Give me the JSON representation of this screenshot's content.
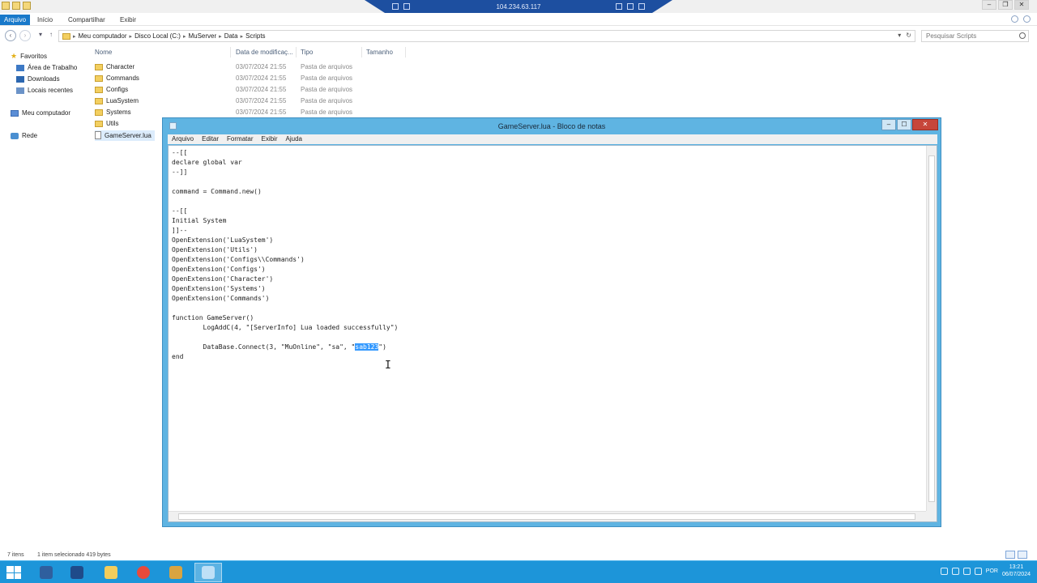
{
  "rdp": {
    "ip": "104.234.63.117"
  },
  "ribbon": {
    "tabs": [
      "Arquivo",
      "Início",
      "Compartilhar",
      "Exibir"
    ]
  },
  "address": {
    "crumbs": [
      "Meu computador",
      "Disco Local (C:)",
      "MuServer",
      "Data",
      "Scripts"
    ],
    "search_placeholder": "Pesquisar Scripts"
  },
  "navpane": {
    "favorites": "Favoritos",
    "desktop": "Área de Trabalho",
    "downloads": "Downloads",
    "recent": "Locais recentes",
    "computer": "Meu computador",
    "network": "Rede"
  },
  "filelist": {
    "columns": [
      "Nome",
      "Data de modificaç...",
      "Tipo",
      "Tamanho"
    ],
    "rows": [
      {
        "name": "Character",
        "date": "03/07/2024 21:55",
        "type": "Pasta de arquivos"
      },
      {
        "name": "Commands",
        "date": "03/07/2024 21:55",
        "type": "Pasta de arquivos"
      },
      {
        "name": "Configs",
        "date": "03/07/2024 21:55",
        "type": "Pasta de arquivos"
      },
      {
        "name": "LuaSystem",
        "date": "03/07/2024 21:55",
        "type": "Pasta de arquivos"
      },
      {
        "name": "Systems",
        "date": "03/07/2024 21:55",
        "type": "Pasta de arquivos"
      },
      {
        "name": "Utils",
        "date": "",
        "type": ""
      },
      {
        "name": "GameServer.lua",
        "date": "",
        "type": ""
      }
    ]
  },
  "status": {
    "count": "7 itens",
    "selected": "1 item selecionado  419 bytes"
  },
  "notepad": {
    "title": "GameServer.lua - Bloco de notas",
    "menus": [
      "Arquivo",
      "Editar",
      "Formatar",
      "Exibir",
      "Ajuda"
    ],
    "lines": [
      "--[[",
      "declare global var",
      "--]]",
      "",
      "command = Command.new()",
      "",
      "--[[",
      "Initial System",
      "]]--",
      "OpenExtension('LuaSystem')",
      "OpenExtension('Utils')",
      "OpenExtension('Configs\\\\Commands')",
      "OpenExtension('Configs')",
      "OpenExtension('Character')",
      "OpenExtension('Systems')",
      "OpenExtension('Commands')",
      "",
      "function GameServer()",
      "        LogAddC(4, \"[ServerInfo] Lua loaded successfully\")",
      "",
      "        DataBase.Connect(3, \"MuOnline\", \"sa\", \"",
      "end"
    ],
    "selected_line_index": 20,
    "selected_text": "sab123",
    "selected_suffix": "\")"
  },
  "tray": {
    "lang": "POR",
    "time": "13:21",
    "date": "06/07/2024"
  }
}
